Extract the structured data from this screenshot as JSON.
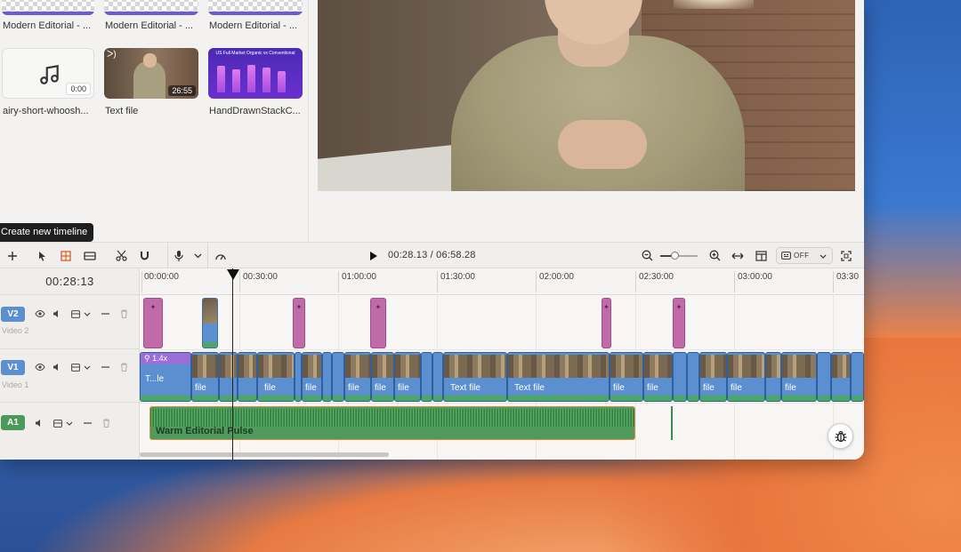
{
  "media": {
    "items": [
      {
        "caption": "Modern Editorial - ...",
        "kind": "transition"
      },
      {
        "caption": "Modern Editorial - ...",
        "kind": "transition"
      },
      {
        "caption": "Modern Editorial - ...",
        "kind": "transition"
      },
      {
        "caption": "airy-short-whoosh...",
        "kind": "audio",
        "duration": "0:00"
      },
      {
        "caption": "Text file",
        "kind": "video",
        "duration": "26:55"
      },
      {
        "caption": "HandDrawnStackC...",
        "kind": "chart",
        "chart_title": "US Full Market Organic vs Conventional"
      }
    ]
  },
  "tooltip": "Create new timeline",
  "toolbar": {
    "timecode": "00:28.13 / 06:58.28",
    "captions_state": "OFF",
    "zoom_level": 0.4,
    "icons": [
      "plus-icon",
      "pointer-icon",
      "ripple-icon",
      "trim-icon",
      "scissors-icon",
      "magnet-icon",
      "microphone-icon",
      "chevron-down-icon",
      "speed-icon",
      "play-icon",
      "zoom-out-icon",
      "zoom-in-icon",
      "fit-width-icon",
      "layout-icon",
      "captions-icon",
      "fullscreen-icon"
    ]
  },
  "timeline": {
    "playhead_time": "00:28:13",
    "ruler": [
      "00:00:00",
      "00:30:00",
      "01:00:00",
      "01:30:00",
      "02:00:00",
      "02:30:00",
      "03:00:00",
      "03:30"
    ],
    "tracks": [
      {
        "badge": "V2",
        "name": "Video 2"
      },
      {
        "badge": "V1",
        "name": "Video 1"
      },
      {
        "badge": "A1",
        "name": ""
      }
    ],
    "speed_label": "1.4x",
    "title_clip_label": "T...le",
    "clip_label_file": "file",
    "clip_label_text": "Text file",
    "audio_clip": "Warm Editorial Pulse"
  },
  "colors": {
    "v2_clip": "#c06aa8",
    "v1_clip": "#5b8fcf",
    "a1_clip": "#4f9a5c",
    "accent": "#e08a3d"
  }
}
